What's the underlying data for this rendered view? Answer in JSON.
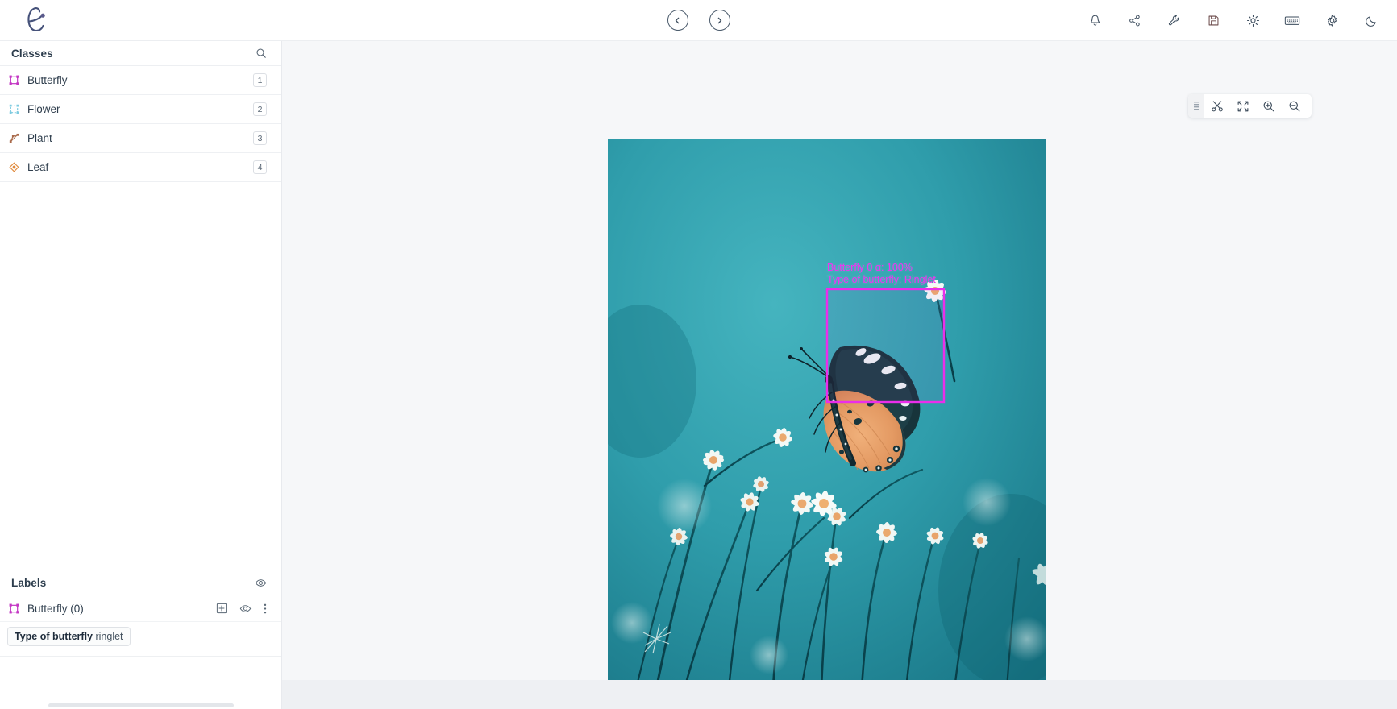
{
  "app": {
    "logo_name": "encord-logo",
    "background": "#ffffff"
  },
  "topbar": {
    "nav": {
      "prev_label": "previous-item",
      "next_label": "next-item"
    },
    "actions": [
      {
        "name": "bell-icon",
        "label": "Notifications"
      },
      {
        "name": "share-icon",
        "label": "Share"
      },
      {
        "name": "wrench-icon",
        "label": "Tools"
      },
      {
        "name": "save-icon",
        "label": "Save"
      },
      {
        "name": "brightness-icon",
        "label": "Brightness"
      },
      {
        "name": "keyboard-icon",
        "label": "Keyboard shortcuts"
      },
      {
        "name": "gear-icon",
        "label": "Settings"
      },
      {
        "name": "moon-icon",
        "label": "Dark mode"
      }
    ]
  },
  "sidebar": {
    "classes_panel": {
      "title": "Classes",
      "search_icon": "search-icon",
      "items": [
        {
          "label": "Butterfly",
          "shortcut": "1",
          "icon": "bounding-box-icon",
          "color": "#c437c4"
        },
        {
          "label": "Flower",
          "shortcut": "2",
          "icon": "polygon-icon",
          "color": "#7ecbe0"
        },
        {
          "label": "Plant",
          "shortcut": "3",
          "icon": "polyline-icon",
          "color": "#a96a4a"
        },
        {
          "label": "Leaf",
          "shortcut": "4",
          "icon": "keypoint-icon",
          "color": "#e08a3c"
        }
      ]
    },
    "labels_panel": {
      "title": "Labels",
      "visibility_icon": "eye-icon",
      "items": [
        {
          "label": "Butterfly (0)",
          "icon": "bounding-box-icon",
          "color": "#c437c4",
          "actions": [
            {
              "name": "add-frame-icon",
              "label": "Add"
            },
            {
              "name": "eye-icon",
              "label": "Toggle visibility"
            },
            {
              "name": "more-icon",
              "label": "More options"
            }
          ],
          "attributes": [
            {
              "name": "Type of butterfly",
              "value": "ringlet"
            }
          ]
        }
      ]
    }
  },
  "canvas": {
    "toolbar": {
      "grip_icon": "drag-handle-icon",
      "tools": [
        {
          "name": "scissors-icon",
          "label": "Cut"
        },
        {
          "name": "fit-screen-icon",
          "label": "Fit to screen"
        },
        {
          "name": "zoom-in-icon",
          "label": "Zoom in"
        },
        {
          "name": "zoom-out-icon",
          "label": "Zoom out"
        }
      ]
    },
    "image": {
      "alt": "Plain tiger butterfly on white daisy flowers against teal background"
    },
    "annotation": {
      "line1": "Butterfly 0 α: 100%",
      "line2": "Type of butterfly: Ringlet",
      "color": "#ea2eea"
    }
  }
}
